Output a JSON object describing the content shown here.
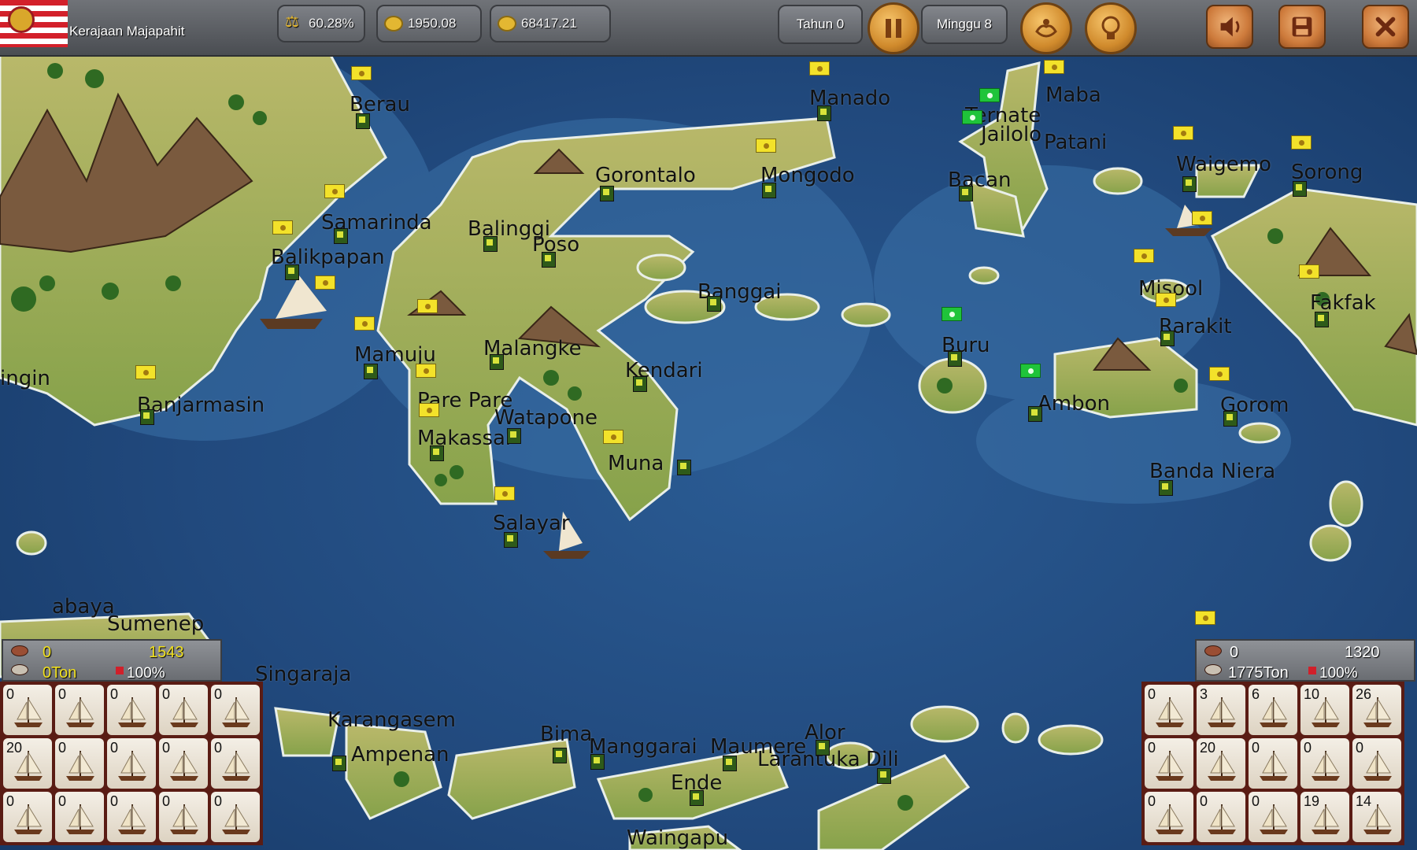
{
  "kingdom": {
    "name": "Kerajaan Majapahit"
  },
  "resources": [
    {
      "id": "stability",
      "icon": "scale-icon",
      "value": "60.28%"
    },
    {
      "id": "gold-gear",
      "icon": "gear-coin-icon",
      "value": "1950.08"
    },
    {
      "id": "treasury",
      "icon": "coin-icon",
      "value": "68417.21"
    }
  ],
  "time": {
    "year": "Tahun 0",
    "week": "Minggu 8"
  },
  "controls": [
    "pause-icon",
    "diplomacy-icon",
    "research-icon",
    "sound-icon",
    "save-icon",
    "close-icon"
  ],
  "places": [
    {
      "id": "berau",
      "label": "Berau"
    },
    {
      "id": "manado",
      "label": "Manado"
    },
    {
      "id": "maba",
      "label": "Maba"
    },
    {
      "id": "ternate",
      "label": "Ternate"
    },
    {
      "id": "jailolo",
      "label": "Jailolo"
    },
    {
      "id": "patani",
      "label": "Patani"
    },
    {
      "id": "gorontalo",
      "label": "Gorontalo"
    },
    {
      "id": "mongodo",
      "label": "Mongodo"
    },
    {
      "id": "bacan",
      "label": "Bacan"
    },
    {
      "id": "waigemo",
      "label": "Waigemo"
    },
    {
      "id": "sorong",
      "label": "Sorong"
    },
    {
      "id": "samarinda",
      "label": "Samarinda"
    },
    {
      "id": "balinggi",
      "label": "Balinggi"
    },
    {
      "id": "poso",
      "label": "Poso"
    },
    {
      "id": "balikpapan",
      "label": "Balikpapan"
    },
    {
      "id": "banggai",
      "label": "Banggai"
    },
    {
      "id": "misool",
      "label": "Misool"
    },
    {
      "id": "fakfak",
      "label": "Fakfak"
    },
    {
      "id": "rarakit",
      "label": "Rarakit"
    },
    {
      "id": "mamuju",
      "label": "Mamuju"
    },
    {
      "id": "malangke",
      "label": "Malangke"
    },
    {
      "id": "buru",
      "label": "Buru"
    },
    {
      "id": "kendari",
      "label": "Kendari"
    },
    {
      "id": "ingin",
      "label": "ingin"
    },
    {
      "id": "banjarmasin",
      "label": "Banjarmasin"
    },
    {
      "id": "parepare",
      "label": "Pare Pare"
    },
    {
      "id": "ambon",
      "label": "Ambon"
    },
    {
      "id": "gorom",
      "label": "Gorom"
    },
    {
      "id": "watapone",
      "label": "Watapone"
    },
    {
      "id": "makassar",
      "label": "Makassar"
    },
    {
      "id": "muna",
      "label": "Muna"
    },
    {
      "id": "bandaniera",
      "label": "Banda Niera"
    },
    {
      "id": "salayar",
      "label": "Salayar"
    },
    {
      "id": "surabaya",
      "label": "abaya"
    },
    {
      "id": "sumenep",
      "label": "Sumenep"
    },
    {
      "id": "singaraja",
      "label": "Singaraja"
    },
    {
      "id": "karangasem",
      "label": "Karangasem"
    },
    {
      "id": "bima",
      "label": "Bima"
    },
    {
      "id": "alor",
      "label": "Alor"
    },
    {
      "id": "ampenan",
      "label": "Ampenan"
    },
    {
      "id": "manggarai",
      "label": "Manggarai"
    },
    {
      "id": "maumere",
      "label": "Maumere"
    },
    {
      "id": "larantuka",
      "label": "Larantuka"
    },
    {
      "id": "dili",
      "label": "Dili"
    },
    {
      "id": "ende",
      "label": "Ende"
    },
    {
      "id": "waingapu",
      "label": "Waingapu"
    }
  ],
  "fleets": [
    {
      "id": "left",
      "guns": "0",
      "soldiers": "1543",
      "cargo": "0Ton",
      "morale": "100%",
      "ships": [
        "0",
        "0",
        "0",
        "0",
        "0",
        "20",
        "0",
        "0",
        "0",
        "0",
        "0",
        "0",
        "0",
        "0",
        "0"
      ]
    },
    {
      "id": "right",
      "guns": "0",
      "soldiers": "1320",
      "cargo": "1775Ton",
      "morale": "100%",
      "ships": [
        "0",
        "3",
        "6",
        "10",
        "26",
        "0",
        "20",
        "0",
        "0",
        "0",
        "0",
        "0",
        "0",
        "19",
        "14"
      ]
    }
  ],
  "colors": {
    "topbar": "#5e6166",
    "sea": "#1f4f88",
    "land": "#8ea84a",
    "mountain": "#7a5a3e",
    "allied_flag": "#f3e22a",
    "enemy_flag": "#1fc43a"
  }
}
